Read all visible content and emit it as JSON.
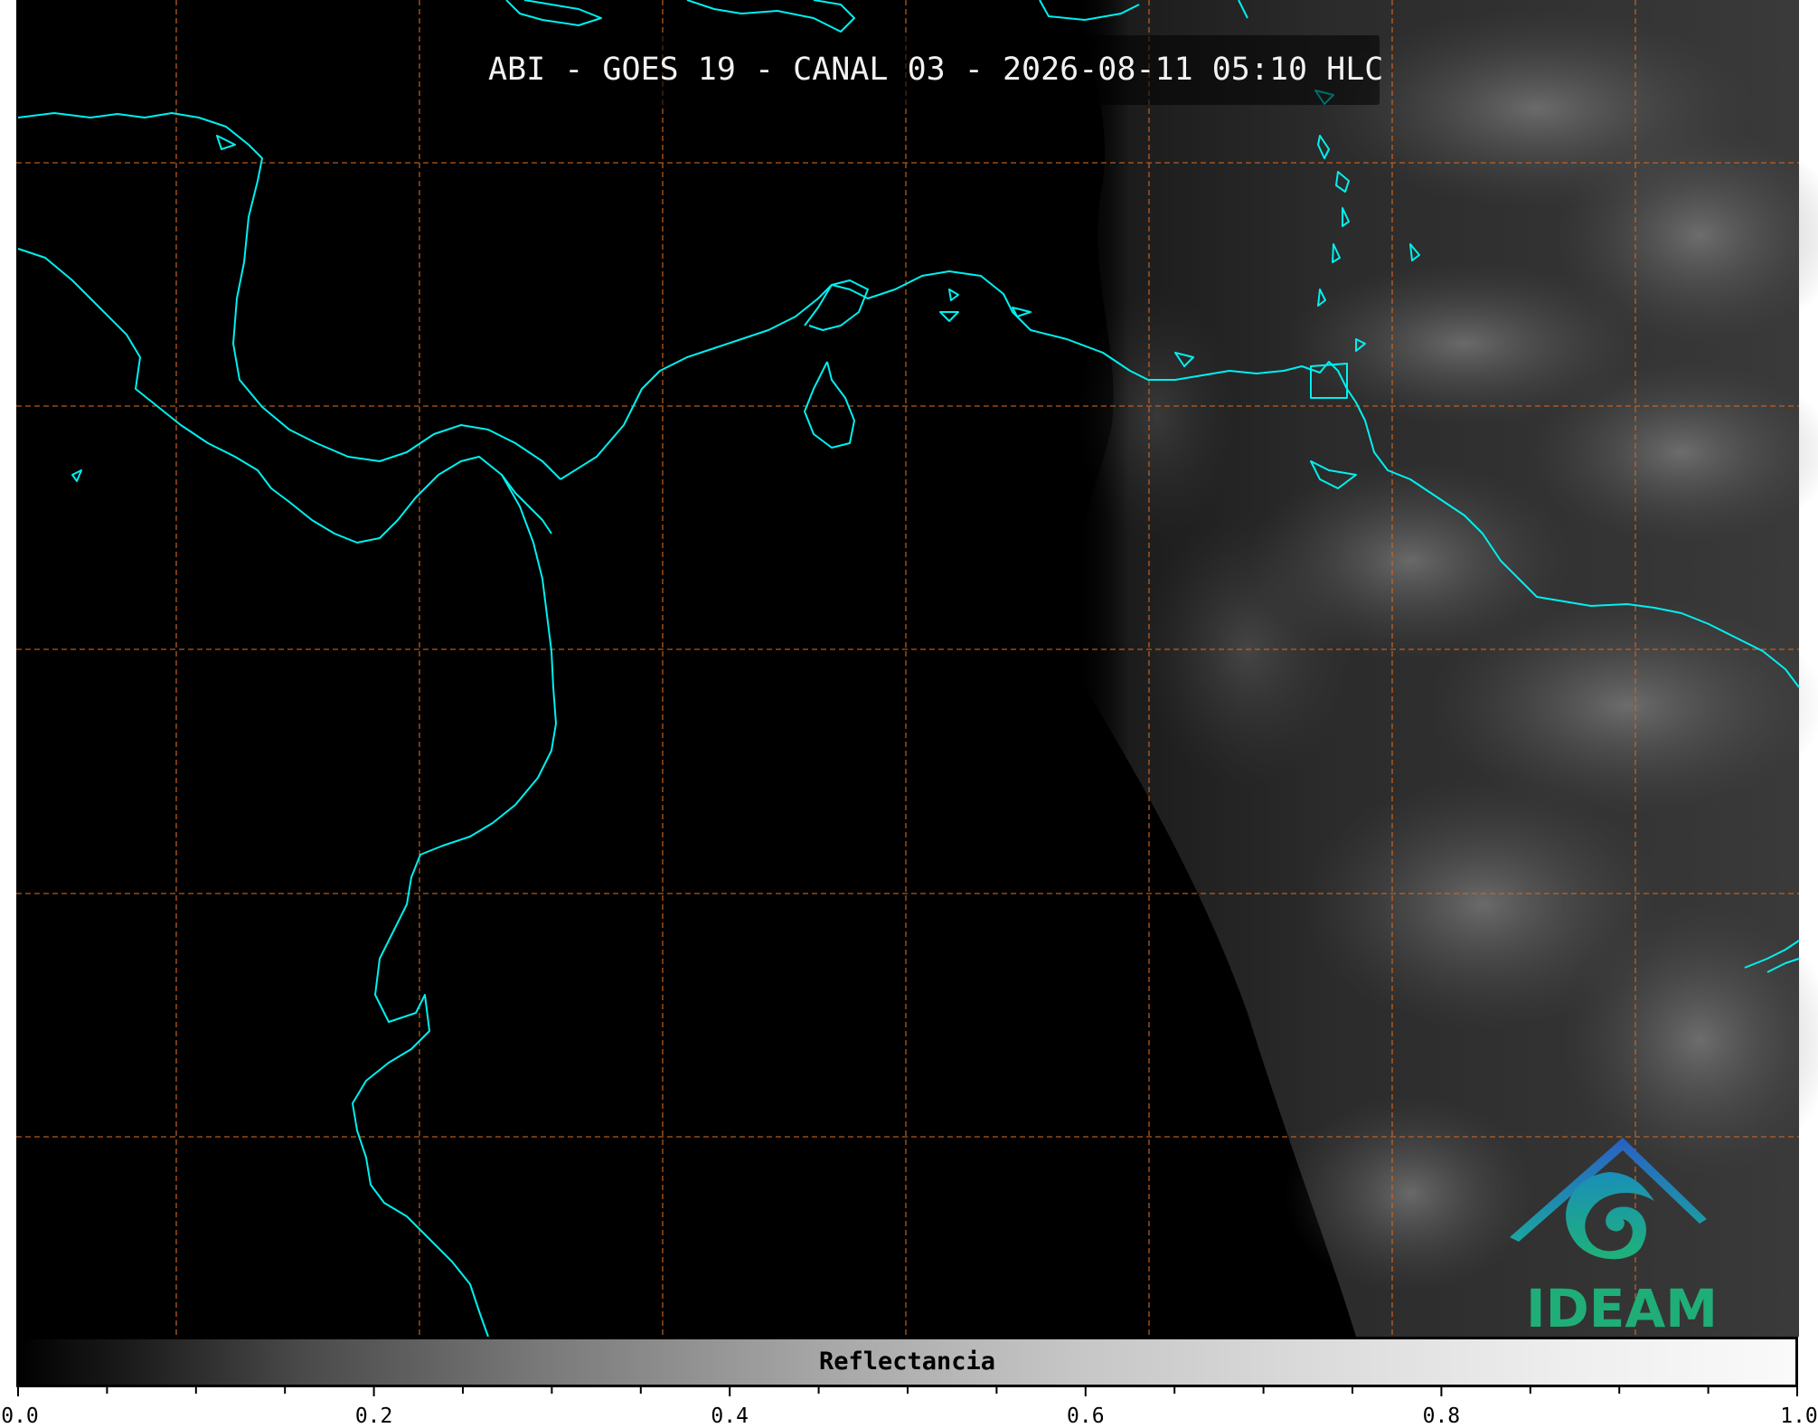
{
  "title": "ABI - GOES 19 - CANAL 03 - 2026-08-11 05:10 HLC",
  "logo": {
    "text": "IDEAM",
    "colors": {
      "mountain": "#2a6fbf",
      "swirl": "#1aa7a0",
      "text": "#1fae77"
    }
  },
  "colorbar": {
    "label": "Reflectancia",
    "range": [
      0.0,
      1.0
    ],
    "tick_labels": [
      "0.0",
      "0.2",
      "0.4",
      "0.6",
      "0.8",
      "1.0"
    ],
    "colormap": "grayscale"
  },
  "map_style": {
    "coastline_color": "#00f0f0",
    "grid_color": "#d2691e",
    "grid_style": "dashed",
    "background": "#000000"
  }
}
